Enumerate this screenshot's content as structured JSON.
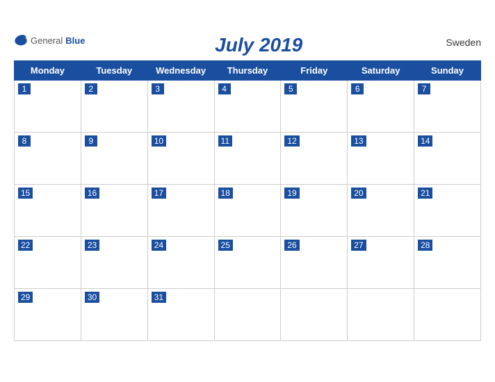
{
  "calendar": {
    "title": "July 2019",
    "country": "Sweden",
    "logo": {
      "general": "General",
      "blue": "Blue"
    },
    "days": [
      "Monday",
      "Tuesday",
      "Wednesday",
      "Thursday",
      "Friday",
      "Saturday",
      "Sunday"
    ],
    "weeks": [
      [
        1,
        2,
        3,
        4,
        5,
        6,
        7
      ],
      [
        8,
        9,
        10,
        11,
        12,
        13,
        14
      ],
      [
        15,
        16,
        17,
        18,
        19,
        20,
        21
      ],
      [
        22,
        23,
        24,
        25,
        26,
        27,
        28
      ],
      [
        29,
        30,
        31,
        null,
        null,
        null,
        null
      ]
    ]
  }
}
